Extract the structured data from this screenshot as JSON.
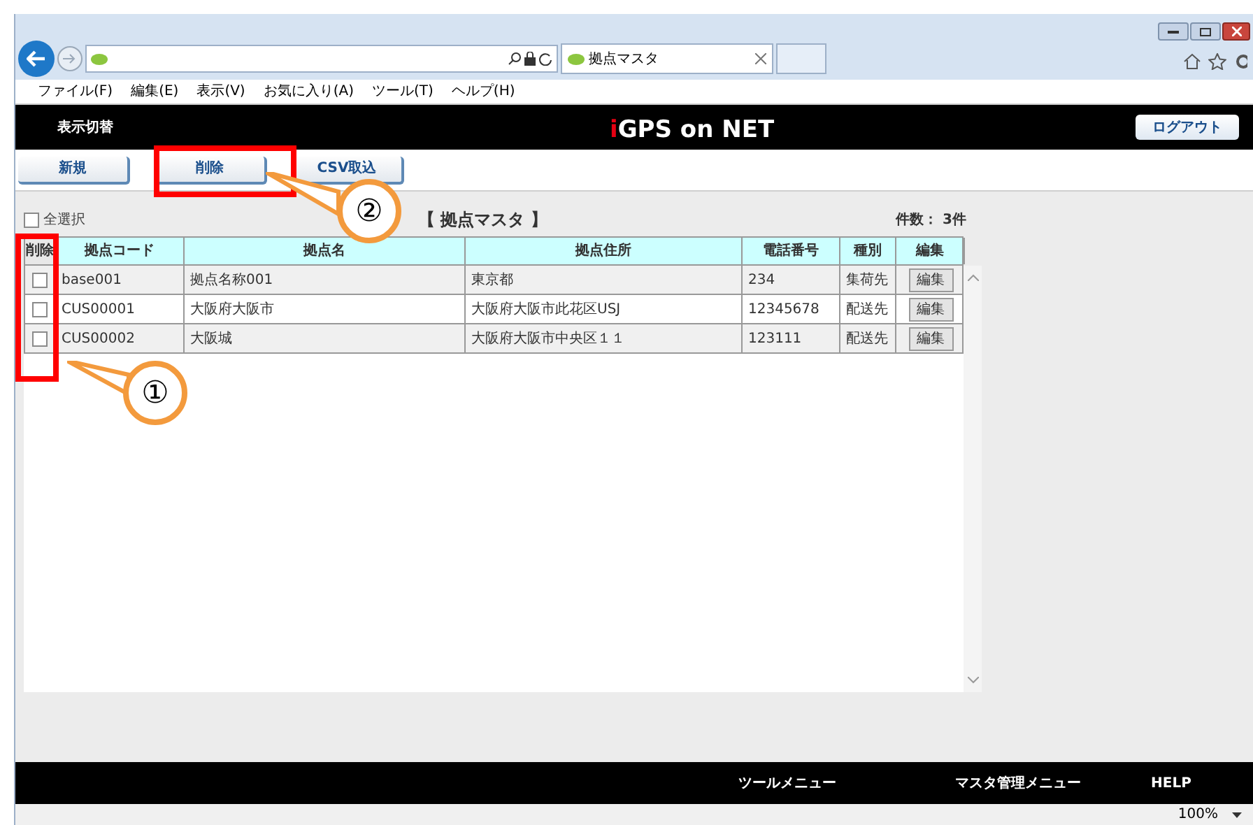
{
  "browser": {
    "tab_title": "拠点マスタ",
    "menu": [
      "ファイル(F)",
      "編集(E)",
      "表示(V)",
      "お気に入り(A)",
      "ツール(T)",
      "ヘルプ(H)"
    ],
    "zoom": "100%"
  },
  "header": {
    "left": "表示切替",
    "logo_mark": "i",
    "logo_text": "GPS on NET",
    "logout": "ログアウト"
  },
  "toolbar": [
    "新規",
    "削除",
    "CSV取込"
  ],
  "select_all": {
    "label": "全選択",
    "checked": false
  },
  "title": "【 拠点マスタ 】",
  "count": "件数： 3件",
  "table": {
    "check_column": "削除",
    "columns": [
      "拠点コード",
      "拠点名",
      "拠点住所",
      "電話番号",
      "種別",
      "編集"
    ],
    "rows": [
      {
        "checked": false,
        "cells": [
          "base001",
          "拠点名称001",
          "東京都",
          "234",
          "集荷先"
        ],
        "edit": "編集"
      },
      {
        "checked": false,
        "cells": [
          "CUS00001",
          "大阪府大阪市",
          "大阪府大阪市此花区USJ",
          "12345678",
          "配送先"
        ],
        "edit": "編集"
      },
      {
        "checked": false,
        "cells": [
          "CUS00002",
          "大阪城",
          "大阪府大阪市中央区１１",
          "123111",
          "配送先"
        ],
        "edit": "編集"
      }
    ]
  },
  "footer": [
    "ツールメニュー",
    "マスタ管理メニュー",
    "HELP"
  ],
  "callouts": [
    {
      "label": "②"
    },
    {
      "label": "①"
    }
  ]
}
